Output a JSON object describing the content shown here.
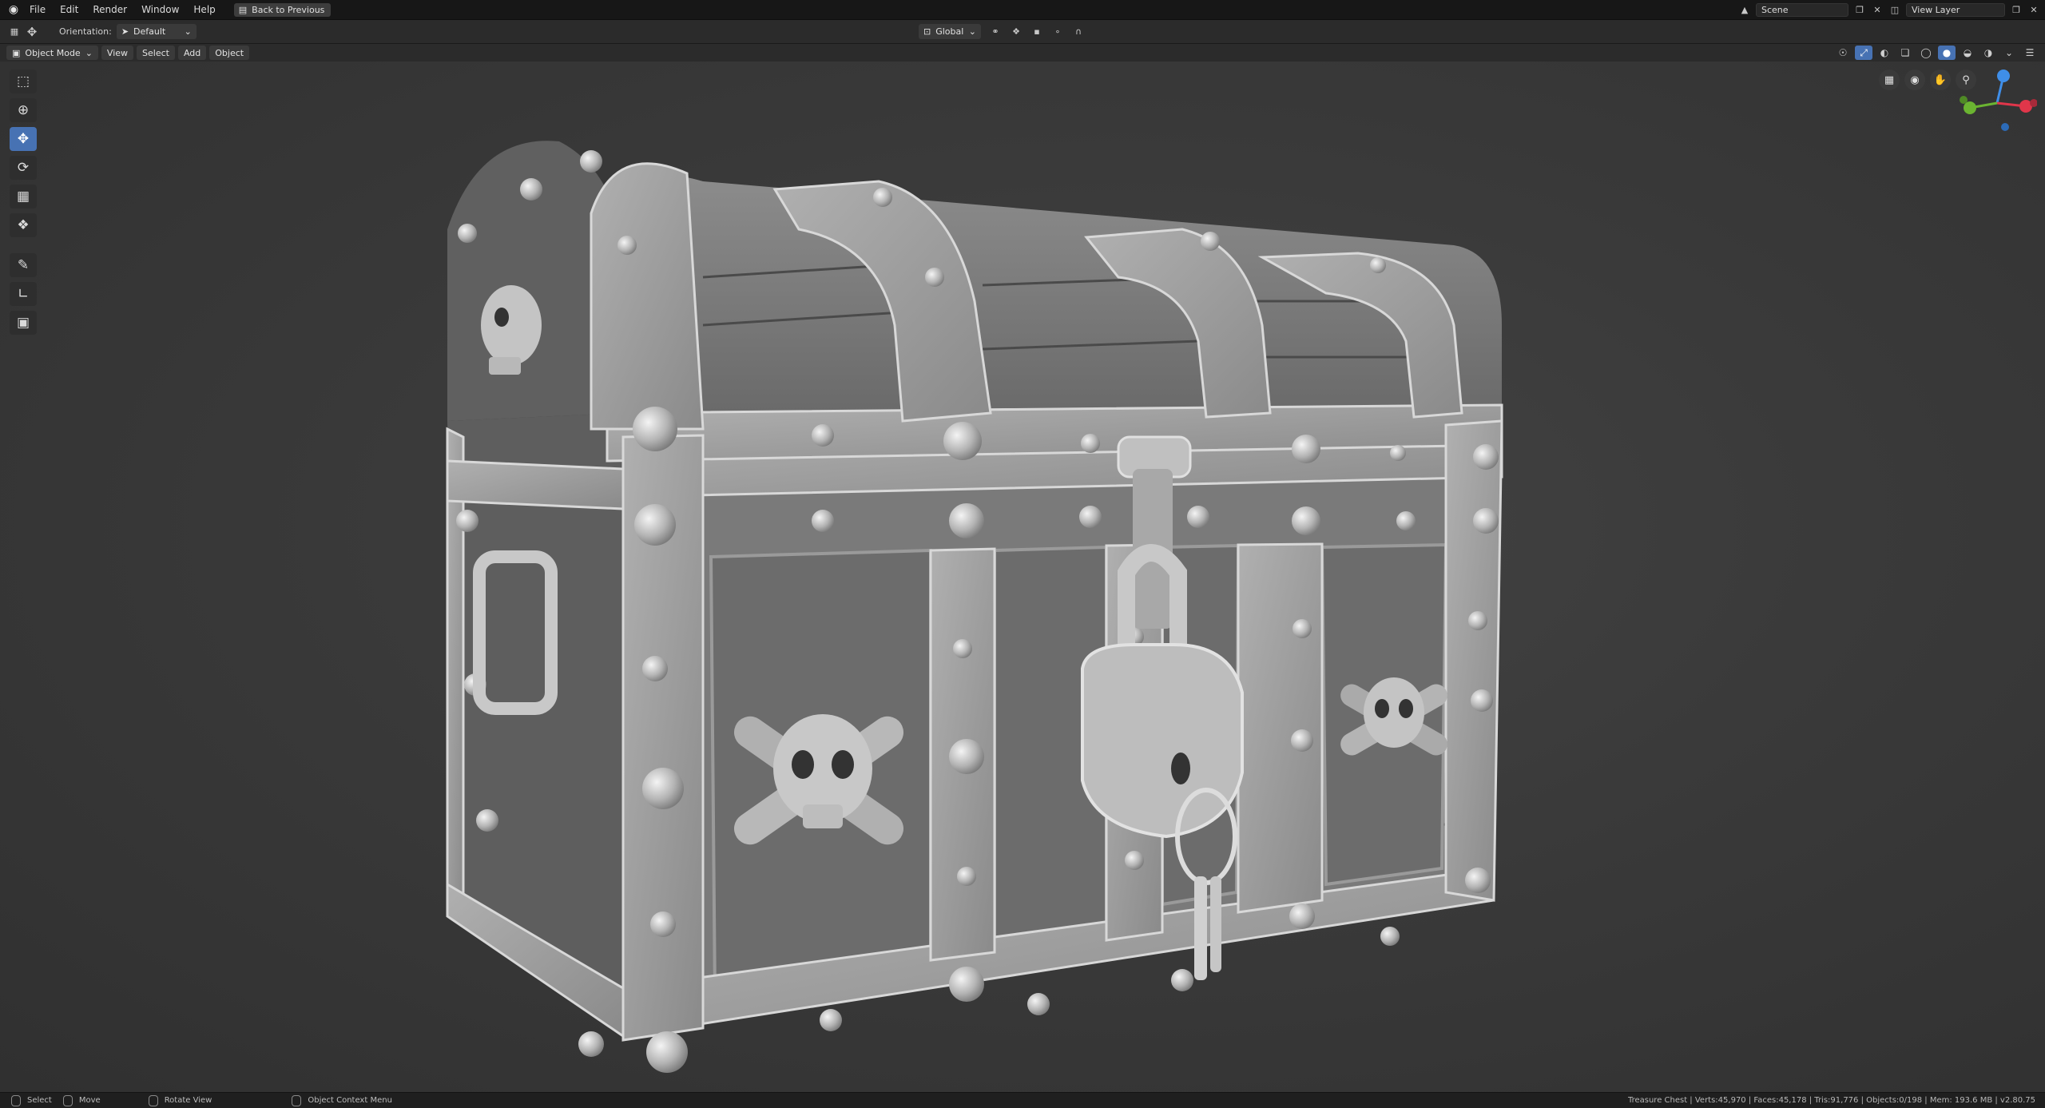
{
  "topbar": {
    "menus": [
      "File",
      "Edit",
      "Render",
      "Window",
      "Help"
    ],
    "back_label": "Back to Previous",
    "scene_label": "Scene",
    "view_layer_label": "View Layer"
  },
  "header": {
    "orientation_label": "Orientation:",
    "orientation_value": "Default",
    "transform_space": "Global"
  },
  "viewport_header": {
    "mode": "Object Mode",
    "menus": [
      "View",
      "Select",
      "Add",
      "Object"
    ]
  },
  "toolbar": {
    "tools": [
      "select-box",
      "cursor",
      "move",
      "rotate",
      "scale",
      "transform",
      "annotate",
      "measure",
      "add-cube"
    ],
    "active": "move"
  },
  "statusbar": {
    "select": "Select",
    "move": "Move",
    "rotate": "Rotate View",
    "context": "Object Context Menu",
    "stats": "Treasure Chest | Verts:45,970 | Faces:45,178 | Tris:91,776 | Objects:0/198 | Mem: 193.6 MB | v2.80.75"
  },
  "colors": {
    "accent": "#4772b3",
    "axis_x": "#e0364a",
    "axis_y": "#6bb431",
    "axis_z": "#3f8ee8"
  }
}
